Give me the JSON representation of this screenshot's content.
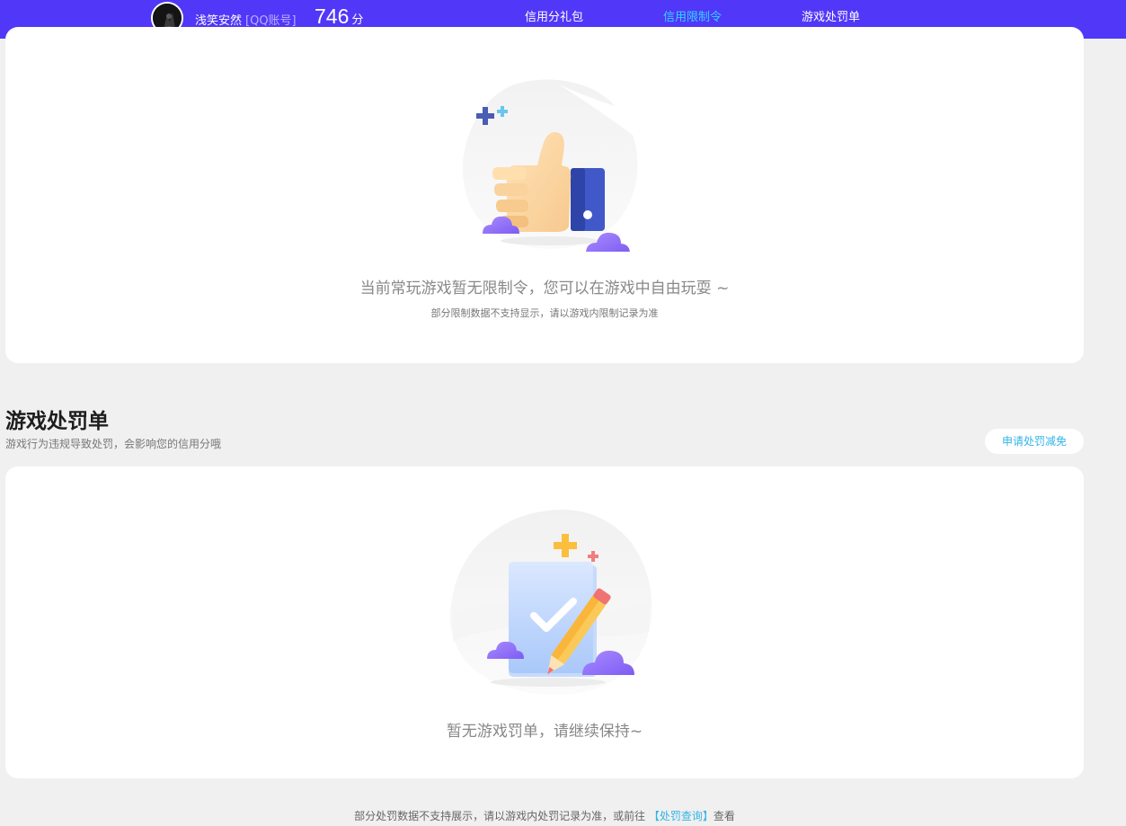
{
  "header": {
    "user_name": "浅笑安然",
    "account_type": "[QQ账号]",
    "score": "746",
    "score_unit": "分",
    "nav": [
      {
        "label": "信用分礼包",
        "active": false
      },
      {
        "label": "信用限制令",
        "active": true
      },
      {
        "label": "游戏处罚单",
        "active": false
      }
    ],
    "accent_color": "#5137f8",
    "active_color": "#33d4ff"
  },
  "restriction": {
    "empty_title": "当前常玩游戏暂无限制令，您可以在游戏中自由玩耍 ~",
    "empty_sub": "部分限制数据不支持显示，请以游戏内限制记录为准",
    "illustration": "thumbs-up-icon"
  },
  "penalty": {
    "title": "游戏处罚单",
    "description": "游戏行为违规导致处罚，会影响您的信用分哦",
    "appeal_button": "申请处罚减免",
    "empty_title": "暂无游戏罚单，请继续保持~",
    "illustration": "checklist-pencil-icon"
  },
  "footer": {
    "note_prefix": "部分处罚数据不支持展示，请以游戏内处罚记录为准，或前往 ",
    "link_text": "【处罚查询】",
    "note_suffix": "查看"
  }
}
